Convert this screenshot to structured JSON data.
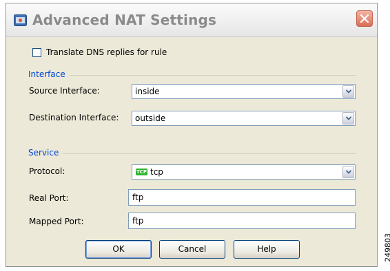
{
  "window": {
    "title": "Advanced NAT Settings"
  },
  "dns": {
    "label": "Translate DNS replies for rule",
    "checked": false
  },
  "interface": {
    "section_label": "Interface",
    "source_label": "Source Interface:",
    "source_value": "inside",
    "destination_label": "Destination Interface:",
    "destination_value": "outside"
  },
  "service": {
    "section_label": "Service",
    "protocol_label": "Protocol:",
    "protocol_badge": "TCP",
    "protocol_value": "tcp",
    "real_port_label": "Real Port:",
    "real_port_value": "ftp",
    "mapped_port_label": "Mapped Port:",
    "mapped_port_value": "ftp"
  },
  "buttons": {
    "ok": "OK",
    "cancel": "Cancel",
    "help": "Help"
  },
  "figure_id": "249803",
  "colors": {
    "section_label": "#0046d5",
    "dialog_bg": "#ece9d8",
    "tcp_badge": "#2fb42f"
  }
}
